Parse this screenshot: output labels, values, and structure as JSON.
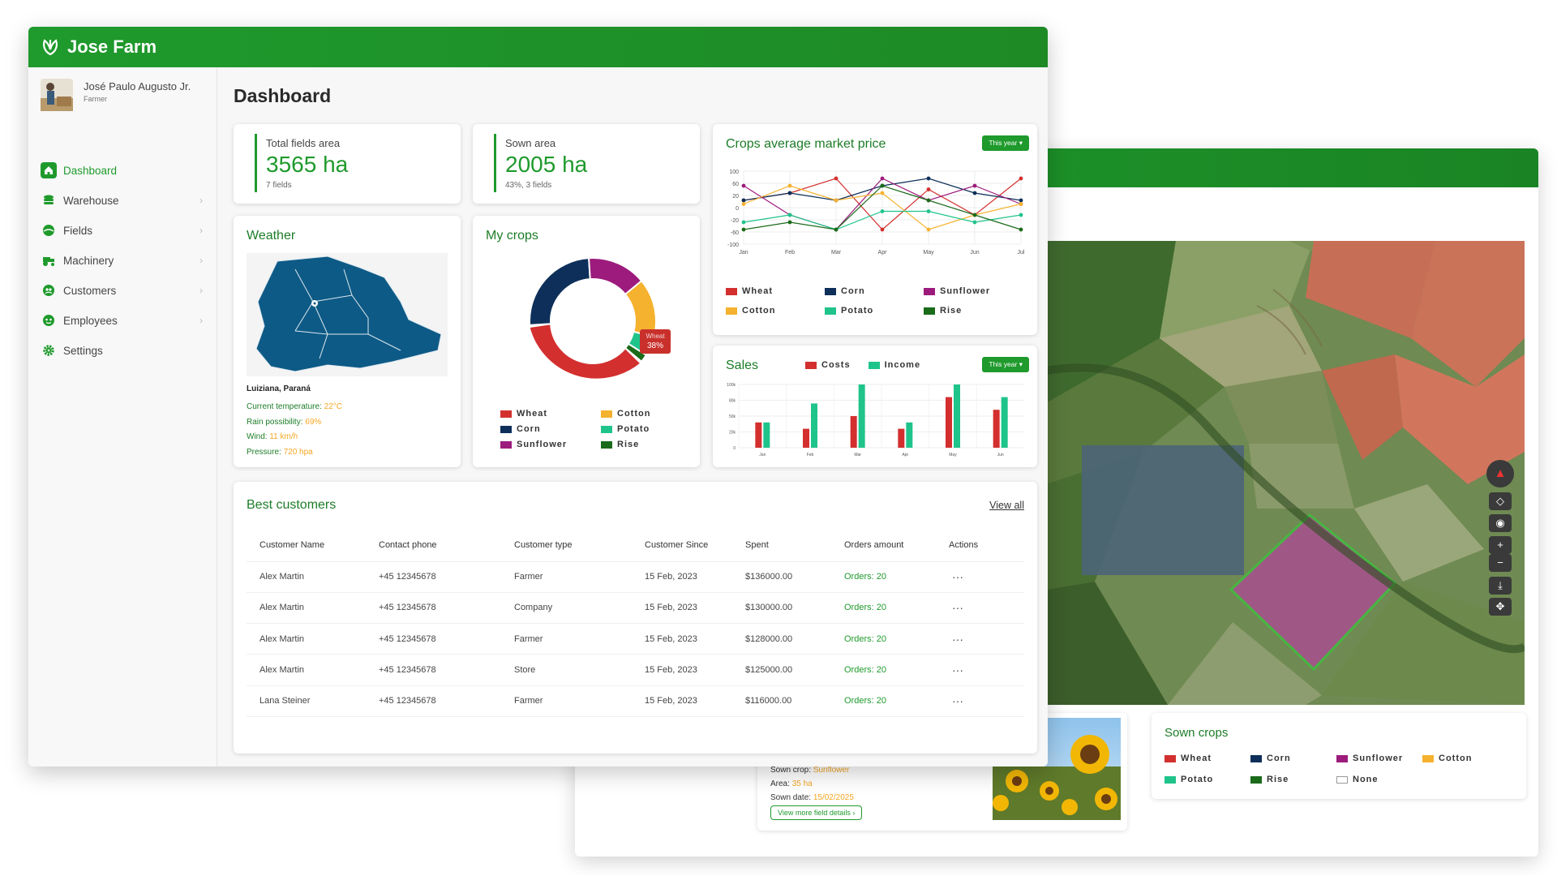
{
  "app": {
    "name": "Jose Farm"
  },
  "user": {
    "name": "José Paulo Augusto Jr.",
    "role": "Farmer"
  },
  "nav": [
    {
      "label": "Dashboard",
      "active": true,
      "icon": "home-icon"
    },
    {
      "label": "Warehouse",
      "icon": "warehouse-icon"
    },
    {
      "label": "Fields",
      "icon": "fields-icon"
    },
    {
      "label": "Machinery",
      "icon": "tractor-icon"
    },
    {
      "label": "Customers",
      "icon": "customers-icon"
    },
    {
      "label": "Employees",
      "icon": "employees-icon"
    },
    {
      "label": "Settings",
      "icon": "gear-icon"
    }
  ],
  "page_title": "Dashboard",
  "stats": [
    {
      "label": "Total fields area",
      "value": "3565 ha",
      "sub": "7 fields"
    },
    {
      "label": "Sown area",
      "value": "2005 ha",
      "sub": "43%, 3 fields"
    }
  ],
  "weather": {
    "title": "Weather",
    "location": "Luiziana, Paraná",
    "rows": [
      {
        "label": "Current temperature:",
        "value": "22°C"
      },
      {
        "label": "Rain possibility:",
        "value": "69%"
      },
      {
        "label": "Wind:",
        "value": "11 km/h"
      },
      {
        "label": "Pressure:",
        "value": "720 hpa"
      }
    ]
  },
  "my_crops": {
    "title": "My crops",
    "tooltip_label": "Wheat",
    "tooltip_value": "38%",
    "legend": [
      "Wheat",
      "Cotton",
      "Corn",
      "Potato",
      "Sunflower",
      "Rise"
    ]
  },
  "colors": {
    "brand": "#1f9a2c",
    "wheat": "#d32f2f",
    "corn": "#0d2f5a",
    "sunflower": "#9c1b7c",
    "cotton": "#f5b22e",
    "potato": "#1fc48b",
    "rise": "#1a6b1a",
    "orders": "#1f9a2c"
  },
  "market_price": {
    "title": "Crops average market price",
    "period": "This year"
  },
  "sales": {
    "title": "Sales",
    "period": "This year",
    "legend": [
      "Costs",
      "Income"
    ]
  },
  "chart_data": [
    {
      "type": "pie",
      "title": "My crops",
      "categories": [
        "Wheat",
        "Corn",
        "Sunflower",
        "Cotton",
        "Potato",
        "Rise"
      ],
      "values": [
        38,
        25,
        15,
        15,
        5,
        2
      ]
    },
    {
      "type": "line",
      "title": "Crops average market price",
      "categories": [
        "Jan",
        "Feb",
        "Mar",
        "Apr",
        "May",
        "Jun",
        "Jul"
      ],
      "yticks": [
        100,
        60,
        20,
        0,
        -20,
        -60,
        -100
      ],
      "series": [
        {
          "name": "Wheat",
          "values": [
            20,
            40,
            80,
            -60,
            50,
            -20,
            80
          ]
        },
        {
          "name": "Corn",
          "values": [
            20,
            40,
            20,
            60,
            80,
            40,
            20
          ]
        },
        {
          "name": "Sunflower",
          "values": [
            60,
            -20,
            -60,
            80,
            20,
            60,
            10
          ]
        },
        {
          "name": "Cotton",
          "values": [
            10,
            60,
            20,
            40,
            -60,
            -20,
            10
          ]
        },
        {
          "name": "Potato",
          "values": [
            -40,
            -20,
            -60,
            -10,
            -10,
            -40,
            -20
          ]
        },
        {
          "name": "Rise",
          "values": [
            -60,
            -40,
            -60,
            60,
            20,
            -20,
            -60
          ]
        }
      ]
    },
    {
      "type": "bar",
      "title": "Sales",
      "categories": [
        "Jan",
        "Feb",
        "Mar",
        "Apr",
        "May",
        "Jun"
      ],
      "yticks": [
        "100k",
        "80k",
        "50k",
        "20k",
        "0"
      ],
      "ylim": [
        0,
        100
      ],
      "series": [
        {
          "name": "Costs",
          "values": [
            40,
            30,
            50,
            30,
            80,
            60
          ]
        },
        {
          "name": "Income",
          "values": [
            40,
            70,
            100,
            40,
            100,
            80
          ]
        }
      ]
    }
  ],
  "customers": {
    "title": "Best customers",
    "view_all": "View all",
    "columns": [
      "Customer Name",
      "Contact phone",
      "Customer type",
      "Customer Since",
      "Spent",
      "Orders amount",
      "Actions"
    ],
    "rows": [
      [
        "Alex Martin",
        "+45 12345678",
        "Farmer",
        "15 Feb, 2023",
        "$136000.00",
        "Orders: 20",
        "···"
      ],
      [
        "Alex Martin",
        "+45 12345678",
        "Company",
        "15 Feb, 2023",
        "$130000.00",
        "Orders: 20",
        "···"
      ],
      [
        "Alex Martin",
        "+45 12345678",
        "Farmer",
        "15 Feb, 2023",
        "$128000.00",
        "Orders: 20",
        "···"
      ],
      [
        "Alex Martin",
        "+45 12345678",
        "Store",
        "15 Feb, 2023",
        "$125000.00",
        "Orders: 20",
        "···"
      ],
      [
        "Lana Steiner",
        "+45 12345678",
        "Farmer",
        "15 Feb, 2023",
        "$116000.00",
        "Orders: 20",
        "···"
      ]
    ]
  },
  "field_details": {
    "rows": [
      {
        "label": "Sown crop:",
        "value": "Sunflower"
      },
      {
        "label": "Area:",
        "value": "35 ha"
      },
      {
        "label": "Sown date:",
        "value": "15/02/2025"
      }
    ],
    "button": "View more field details"
  },
  "sown_crops": {
    "title": "Sown crops",
    "legend": [
      "Wheat",
      "Corn",
      "Sunflower",
      "Cotton",
      "Potato",
      "Rise",
      "None"
    ]
  }
}
